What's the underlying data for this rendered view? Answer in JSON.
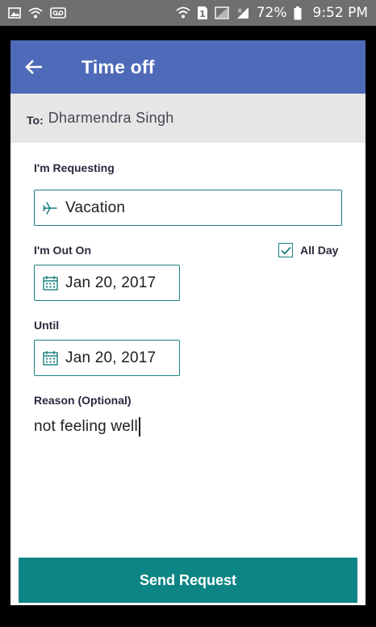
{
  "status_bar": {
    "battery": "72%",
    "time": "9:52 PM",
    "left_icons": [
      "gallery-icon",
      "wifi-call-icon",
      "voicemail-icon"
    ],
    "right_icons": [
      "wifi-icon",
      "sim-1-icon",
      "signal-icon",
      "signal-r-icon",
      "battery-icon"
    ]
  },
  "app_bar": {
    "title": "Time off",
    "back_icon": "arrow-left-icon",
    "color": "#4f6ab8"
  },
  "recipient": {
    "label": "To:",
    "name": "Dharmendra Singh"
  },
  "form": {
    "requesting_label": "I'm Requesting",
    "requesting_value": "Vacation",
    "requesting_icon": "airplane-icon",
    "out_on_label": "I'm Out On",
    "all_day_label": "All Day",
    "all_day_checked": true,
    "out_on_value": "Jan 20, 2017",
    "until_label": "Until",
    "until_value": "Jan 20, 2017",
    "date_icon": "calendar-icon",
    "reason_label": "Reason (Optional)",
    "reason_value": "not feeling well",
    "accent_color": "#1b8080"
  },
  "actions": {
    "send_label": "Send Request",
    "send_color": "#0e8585"
  }
}
